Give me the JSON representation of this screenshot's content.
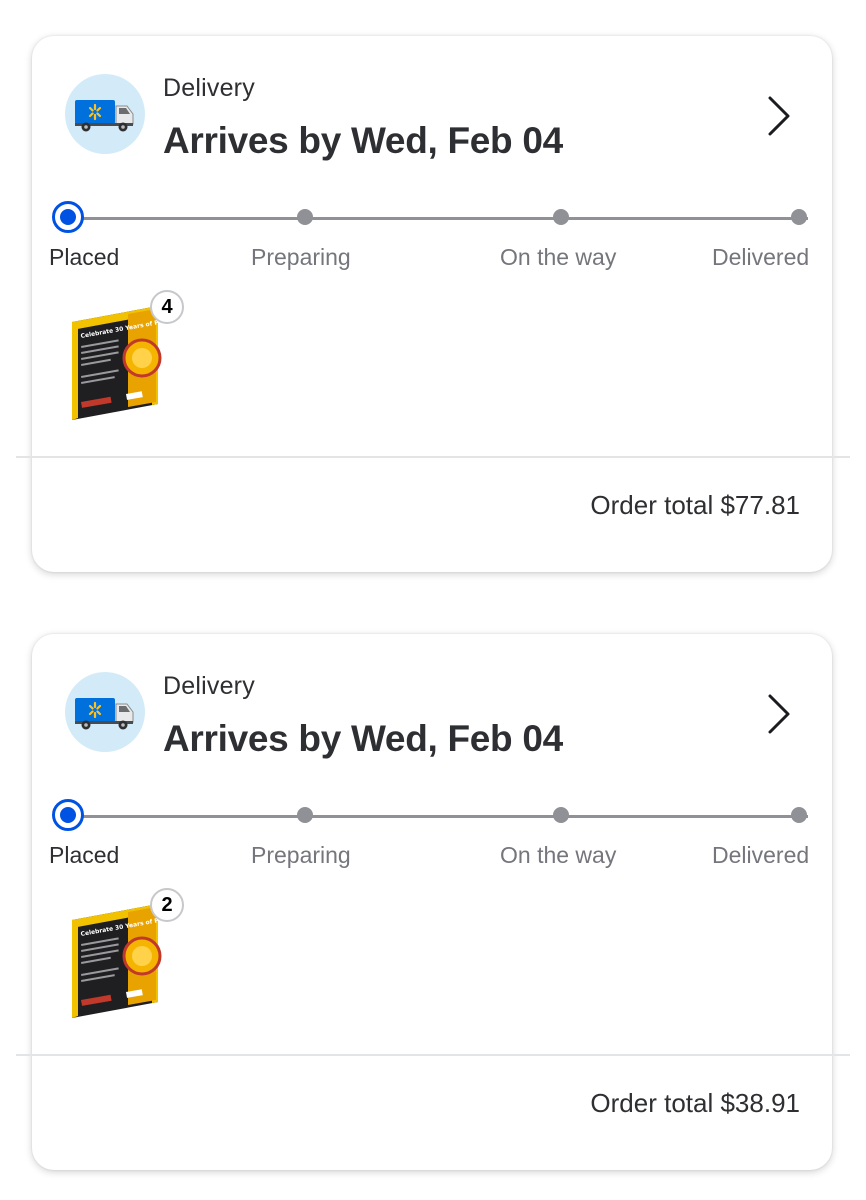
{
  "orders": [
    {
      "delivery_label": "Delivery",
      "arrives_title": "Arrives by Wed, Feb 04",
      "steps": [
        "Placed",
        "Preparing",
        "On the way",
        "Delivered"
      ],
      "current_step": "Placed",
      "item_quantity": "4",
      "order_total": "Order total $77.81",
      "product_box_text": "Celebrate 30 Years of Pokémon!"
    },
    {
      "delivery_label": "Delivery",
      "arrives_title": "Arrives by Wed, Feb 04",
      "steps": [
        "Placed",
        "Preparing",
        "On the way",
        "Delivered"
      ],
      "current_step": "Placed",
      "item_quantity": "2",
      "order_total": "Order total $38.91",
      "product_box_text": "Celebrate 30 Years of Pokémon!"
    }
  ],
  "icons": {
    "truck": "delivery-truck-icon",
    "chevron": "chevron-right-icon"
  },
  "colors": {
    "accent_blue": "#0053e2",
    "truck_badge_bg": "#d3ebf8",
    "inactive_gray": "#909196",
    "spark_yellow": "#ffc220"
  }
}
